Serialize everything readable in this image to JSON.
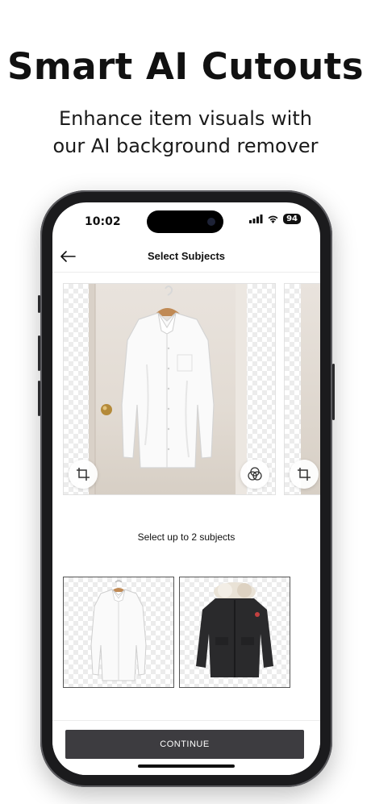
{
  "promo": {
    "headline": "Smart AI Cutouts",
    "subline_1": "Enhance item visuals with",
    "subline_2": "our AI background remover"
  },
  "status_bar": {
    "time": "10:02",
    "battery": "94"
  },
  "nav": {
    "back_icon": "arrow-left-icon",
    "title": "Select Subjects"
  },
  "carousel": {
    "items": [
      {
        "subject": "white dress shirt",
        "left_icon": "crop-icon",
        "right_icon": "color-filter-icon"
      },
      {
        "subject": "next item",
        "left_icon": "crop-icon"
      }
    ]
  },
  "selection": {
    "hint": "Select up to 2 subjects",
    "thumbnails": [
      {
        "subject": "white dress shirt"
      },
      {
        "subject": "black parka with fur hood"
      }
    ]
  },
  "footer": {
    "continue_label": "CONTINUE"
  },
  "colors": {
    "button_bg": "#3d3c40",
    "phone_frame": "#1b1b1d",
    "text": "#111111"
  }
}
